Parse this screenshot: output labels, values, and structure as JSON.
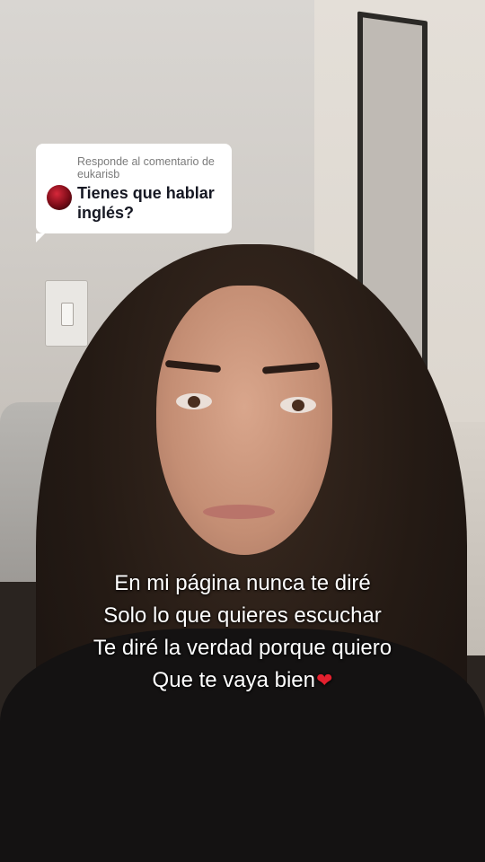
{
  "reply_card": {
    "caption": "Responde al comentario de eukarisb",
    "question": "Tienes que hablar inglés?"
  },
  "overlay_text": {
    "lines": [
      "En mi página nunca te diré",
      "Solo lo que quieres escuchar",
      "Te diré la verdad porque quiero",
      "Que te vaya bien"
    ],
    "trailing_emoji": "❤"
  }
}
